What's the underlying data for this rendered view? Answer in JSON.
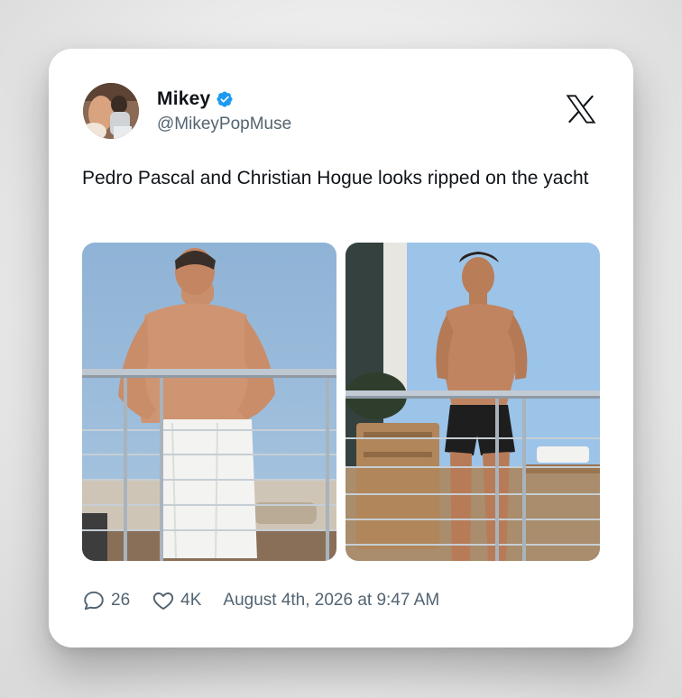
{
  "author": {
    "name": "Mikey",
    "handle": "@MikeyPopMuse",
    "verified": true,
    "verified_color": "#1d9bf0"
  },
  "tweet": {
    "text": "Pedro Pascal and Christian Hogue looks ripped on the yacht",
    "timestamp": "August 4th, 2026 at 9:47 AM"
  },
  "metrics": {
    "replies": "26",
    "likes": "4K"
  },
  "icons": {
    "logo": "x-logo-icon",
    "replies": "speech-bubble-icon",
    "likes": "heart-icon",
    "verified": "verified-badge-icon"
  },
  "colors": {
    "text_primary": "#0f1419",
    "text_secondary": "#536471",
    "card_background": "#ffffff"
  }
}
